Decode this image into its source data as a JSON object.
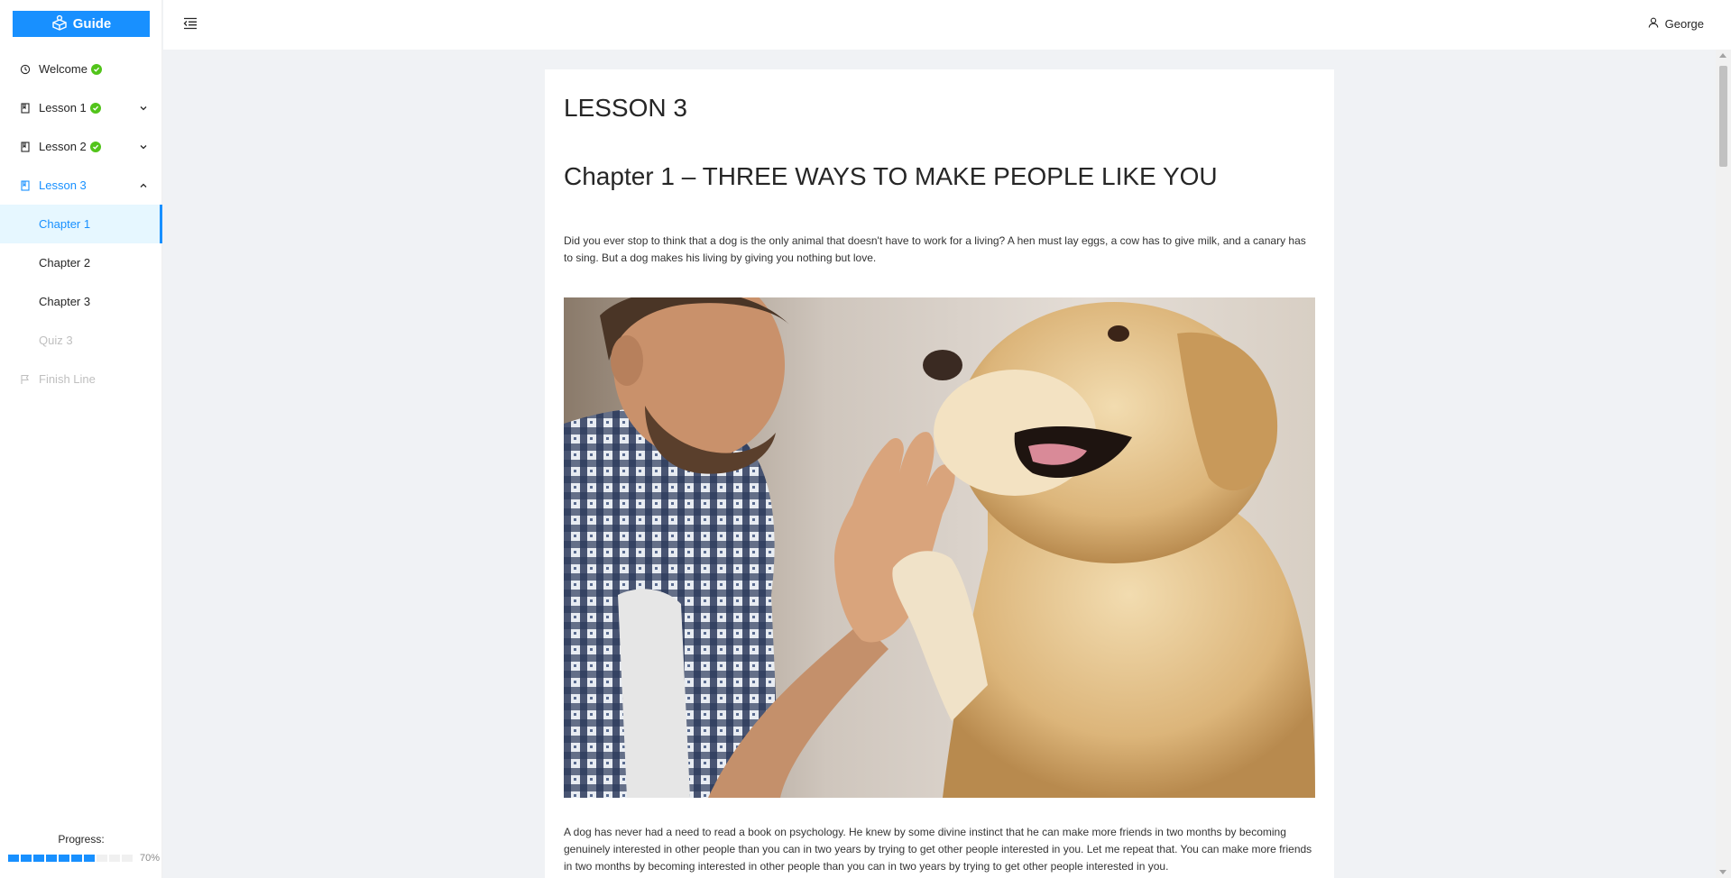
{
  "app": {
    "logo_label": "Guide",
    "logo_icon": "gift-box-icon"
  },
  "header": {
    "user_name": "George",
    "user_icon": "user-icon",
    "menu_fold_icon": "menu-fold-icon"
  },
  "sidebar": {
    "items": [
      {
        "label": "Welcome",
        "icon": "clock-icon",
        "completed": true
      },
      {
        "label": "Lesson 1",
        "icon": "book-icon",
        "completed": true,
        "expanded": false
      },
      {
        "label": "Lesson 2",
        "icon": "book-icon",
        "completed": true,
        "expanded": false
      },
      {
        "label": "Lesson 3",
        "icon": "book-icon",
        "completed": false,
        "expanded": true,
        "children": [
          {
            "label": "Chapter 1",
            "selected": true
          },
          {
            "label": "Chapter 2"
          },
          {
            "label": "Chapter 3"
          },
          {
            "label": "Quiz 3",
            "disabled": true
          }
        ]
      },
      {
        "label": "Finish Line",
        "icon": "flag-icon",
        "disabled": true
      }
    ],
    "progress": {
      "label": "Progress:",
      "percent_text": "70%",
      "value": 0.7
    }
  },
  "content": {
    "lesson_title": "LESSON 3",
    "chapter_title": "Chapter 1 – THREE WAYS TO MAKE PEOPLE LIKE YOU",
    "paragraph_1": "Did you ever stop to think that a dog is the only animal that doesn't have to work for a living? A hen must lay eggs, a cow has to give milk, and a canary has to sing. But a dog makes his living by giving you nothing but love.",
    "paragraph_2": "A dog has never had a need to read a book on psychology. He knew by some divine instinct that he can make more friends in two months by becoming genuinely interested in other people than you can in two years by trying to get other people interested in you. Let me repeat that. You can make more friends in two months by becoming interested in other people than you can in two years by trying to get other people interested in you."
  },
  "colors": {
    "primary": "#1890ff",
    "success": "#52c41a",
    "page_bg": "#f0f2f5",
    "selected_bg": "#e6f7ff"
  }
}
